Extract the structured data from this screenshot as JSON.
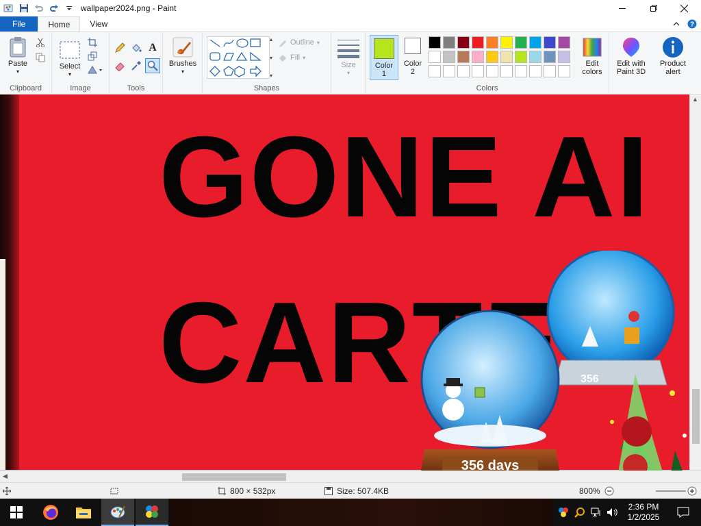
{
  "window": {
    "title": "wallpaper2024.png - Paint",
    "minimize_icon": "minimize-icon",
    "maximize_icon": "restore-icon",
    "close_icon": "close-icon"
  },
  "tabs": [
    {
      "label": "File"
    },
    {
      "label": "Home"
    },
    {
      "label": "View"
    }
  ],
  "ribbon": {
    "clipboard": {
      "label": "Clipboard",
      "paste": "Paste"
    },
    "image": {
      "label": "Image",
      "select": "Select"
    },
    "tools": {
      "label": "Tools"
    },
    "brushes": {
      "label": "Brushes"
    },
    "shapes": {
      "label": "Shapes",
      "outline": "Outline",
      "fill": "Fill"
    },
    "size": {
      "label": "Size"
    },
    "colors": {
      "label": "Colors",
      "color1": "Color\n1",
      "color1_hex": "#b5e61d",
      "color2": "Color\n2",
      "color2_hex": "#ffffff",
      "edit_colors": "Edit\ncolors",
      "palette_row1": [
        "#000000",
        "#7f7f7f",
        "#880015",
        "#ed1c24",
        "#ff7f27",
        "#fff200",
        "#22b14c",
        "#00a2e8",
        "#3f48cc",
        "#a349a4"
      ],
      "palette_row2": [
        "#ffffff",
        "#c3c3c3",
        "#b97a57",
        "#ffaec9",
        "#ffc90e",
        "#efe4b0",
        "#b5e61d",
        "#99d9ea",
        "#7092be",
        "#c8bfe7"
      ]
    },
    "paint3d": "Edit with\nPaint 3D",
    "product_alert": "Product\nalert"
  },
  "canvas": {
    "line1": "GONE AI",
    "line2": "CARTE",
    "globe_text_left": "356 days",
    "globe_text_right": "356"
  },
  "statusbar": {
    "dimensions": "800 × 532px",
    "size": "Size: 507.4KB",
    "zoom": "800%"
  },
  "taskbar": {
    "time": "2:36 PM",
    "date": "1/2/2025"
  }
}
